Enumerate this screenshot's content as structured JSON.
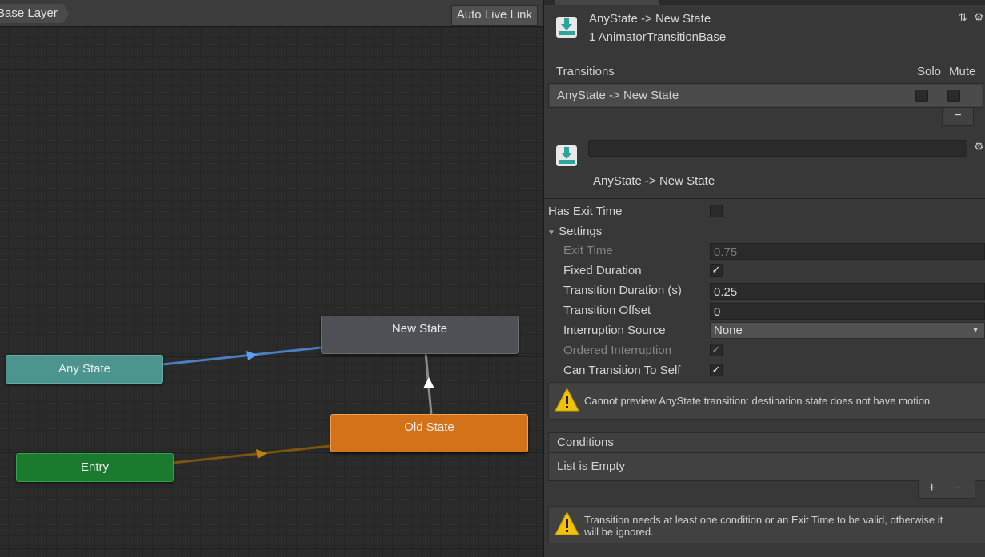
{
  "graph": {
    "breadcrumb": "Base Layer",
    "live_link_label": "Auto Live Link",
    "nodes": {
      "new_state": "New State",
      "any_state": "Any State",
      "old_state": "Old State",
      "entry": "Entry"
    },
    "colors": {
      "any_state": "#4b958e",
      "old_state": "#d4721a",
      "entry": "#1a7a2e",
      "new_state": "#4e5055",
      "any_edge": "#4a7fc0",
      "entry_edge": "#7a5410"
    }
  },
  "inspector": {
    "header": {
      "title": "AnyState -> New State",
      "subtitle": "1 AnimatorTransitionBase",
      "icon": "transition-icon"
    },
    "transitions": {
      "header": "Transitions",
      "solo_label": "Solo",
      "mute_label": "Mute",
      "rows": [
        {
          "name": "AnyState -> New State",
          "solo": false,
          "mute": false
        }
      ],
      "remove_label": "−"
    },
    "transition": {
      "name_value": "",
      "label": "AnyState -> New State"
    },
    "properties": {
      "has_exit_time_label": "Has Exit Time",
      "has_exit_time": false,
      "settings_label": "Settings",
      "exit_time_label": "Exit Time",
      "exit_time_value": "0.75",
      "fixed_duration_label": "Fixed Duration",
      "fixed_duration": true,
      "transition_duration_label": "Transition Duration (s)",
      "transition_duration_value": "0.25",
      "transition_offset_label": "Transition Offset",
      "transition_offset_value": "0",
      "interruption_source_label": "Interruption Source",
      "interruption_source_value": "None",
      "ordered_interruption_label": "Ordered Interruption",
      "ordered_interruption": true,
      "can_transition_to_self_label": "Can Transition To Self",
      "can_transition_to_self": true
    },
    "preview_warning": "Cannot preview AnyState transition:  destination state does not have motion",
    "conditions": {
      "header": "Conditions",
      "empty": "List is Empty",
      "add_label": "+",
      "remove_label": "−"
    },
    "condition_warning_1": "Transition needs at least one condition or an Exit Time to be valid, otherwise it",
    "condition_warning_2": "will be ignored."
  }
}
